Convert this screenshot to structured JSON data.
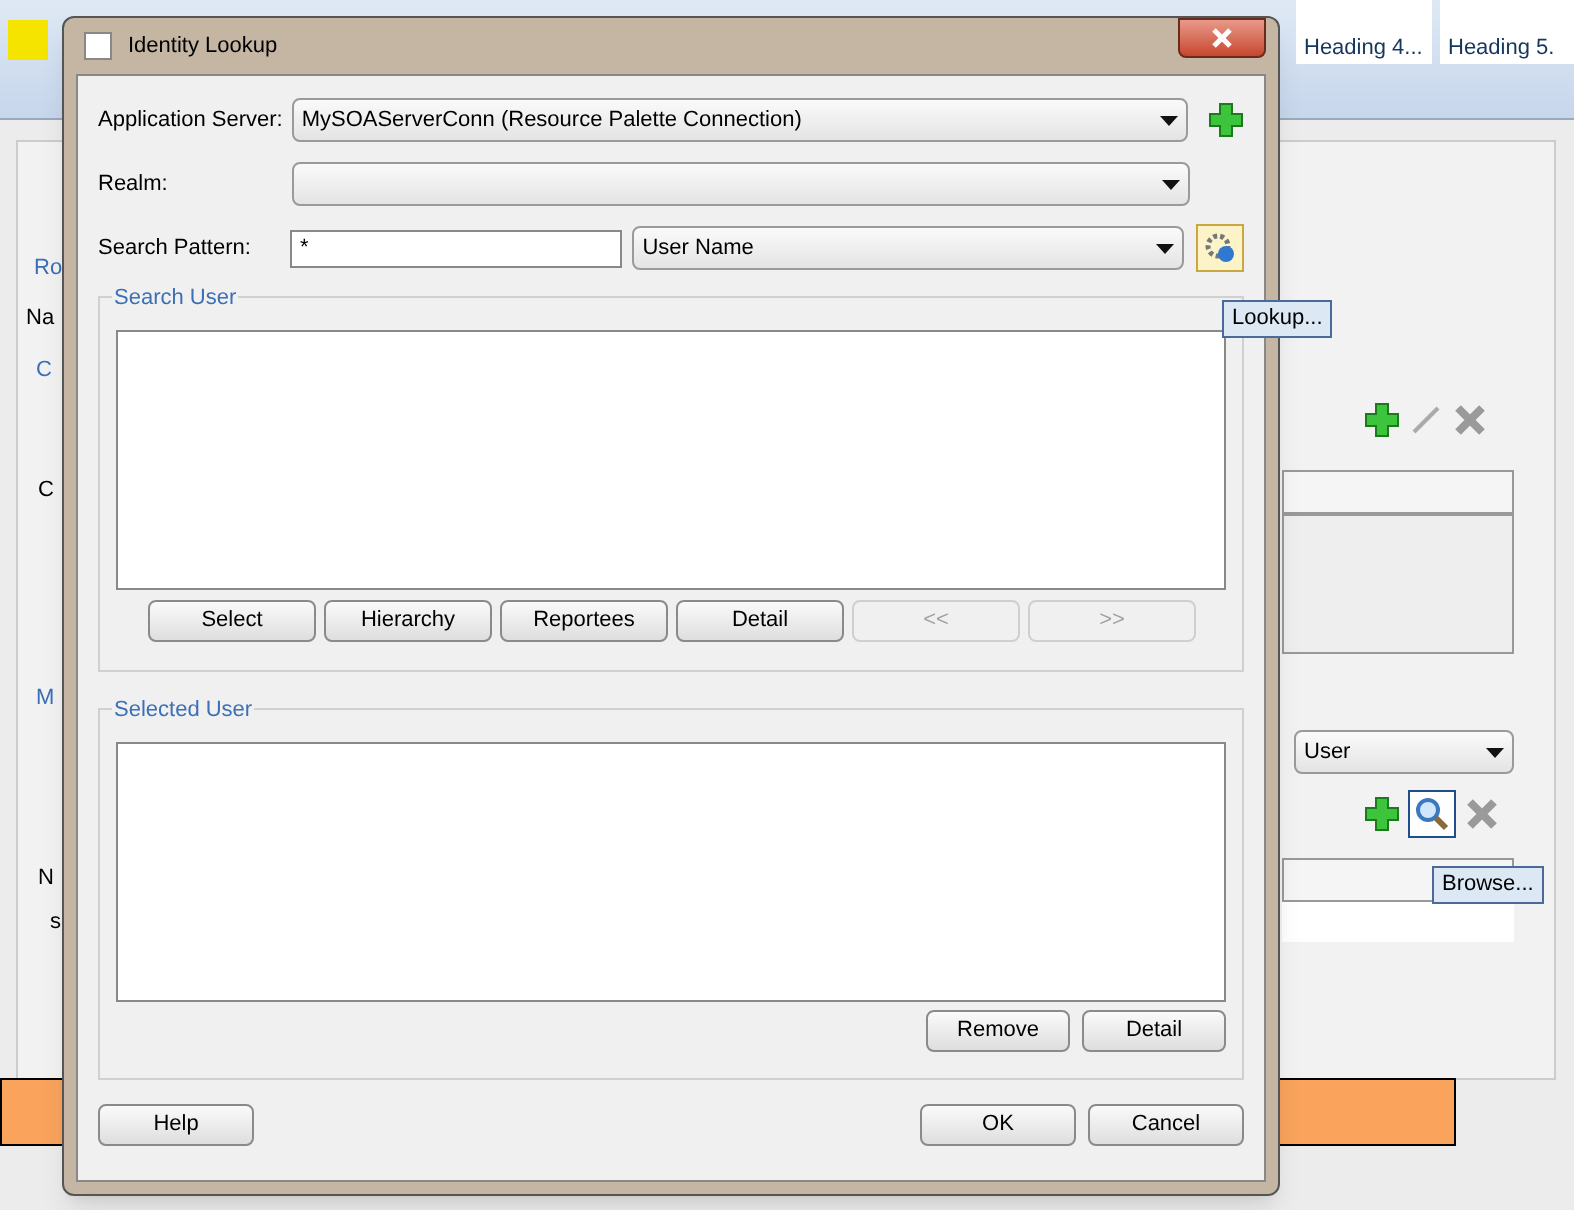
{
  "background": {
    "ribbon_styles": [
      {
        "label": "Heading 4..."
      },
      {
        "label": "Heading 5."
      }
    ],
    "fragments": {
      "section_1": "Ro",
      "name_label": "Na",
      "group_1": "C",
      "table_header": "C",
      "group_2": "M",
      "table_header_2": "N",
      "table_cell": "s"
    },
    "type_dropdown": {
      "value": "User"
    },
    "tooltips": {
      "lookup": "Lookup...",
      "browse": "Browse..."
    }
  },
  "dialog": {
    "title": "Identity Lookup",
    "application_server": {
      "label": "Application Server:",
      "value": "MySOAServerConn (Resource Palette Connection)"
    },
    "realm": {
      "label": "Realm:"
    },
    "search_pattern": {
      "label": "Search Pattern:",
      "value": "*",
      "type": "User Name"
    },
    "search_user": {
      "title": "Search User",
      "buttons": [
        {
          "label": "Select",
          "disabled": false
        },
        {
          "label": "Hierarchy",
          "disabled": false
        },
        {
          "label": "Reportees",
          "disabled": false
        },
        {
          "label": "Detail",
          "disabled": false
        },
        {
          "label": "<<",
          "disabled": true
        },
        {
          "label": ">>",
          "disabled": true
        }
      ]
    },
    "selected_user": {
      "title": "Selected User",
      "buttons": [
        {
          "label": "Remove",
          "disabled": false
        },
        {
          "label": "Detail",
          "disabled": false
        }
      ]
    },
    "footer_buttons": [
      {
        "label": "Help"
      },
      {
        "label": "OK"
      },
      {
        "label": "Cancel"
      }
    ]
  }
}
